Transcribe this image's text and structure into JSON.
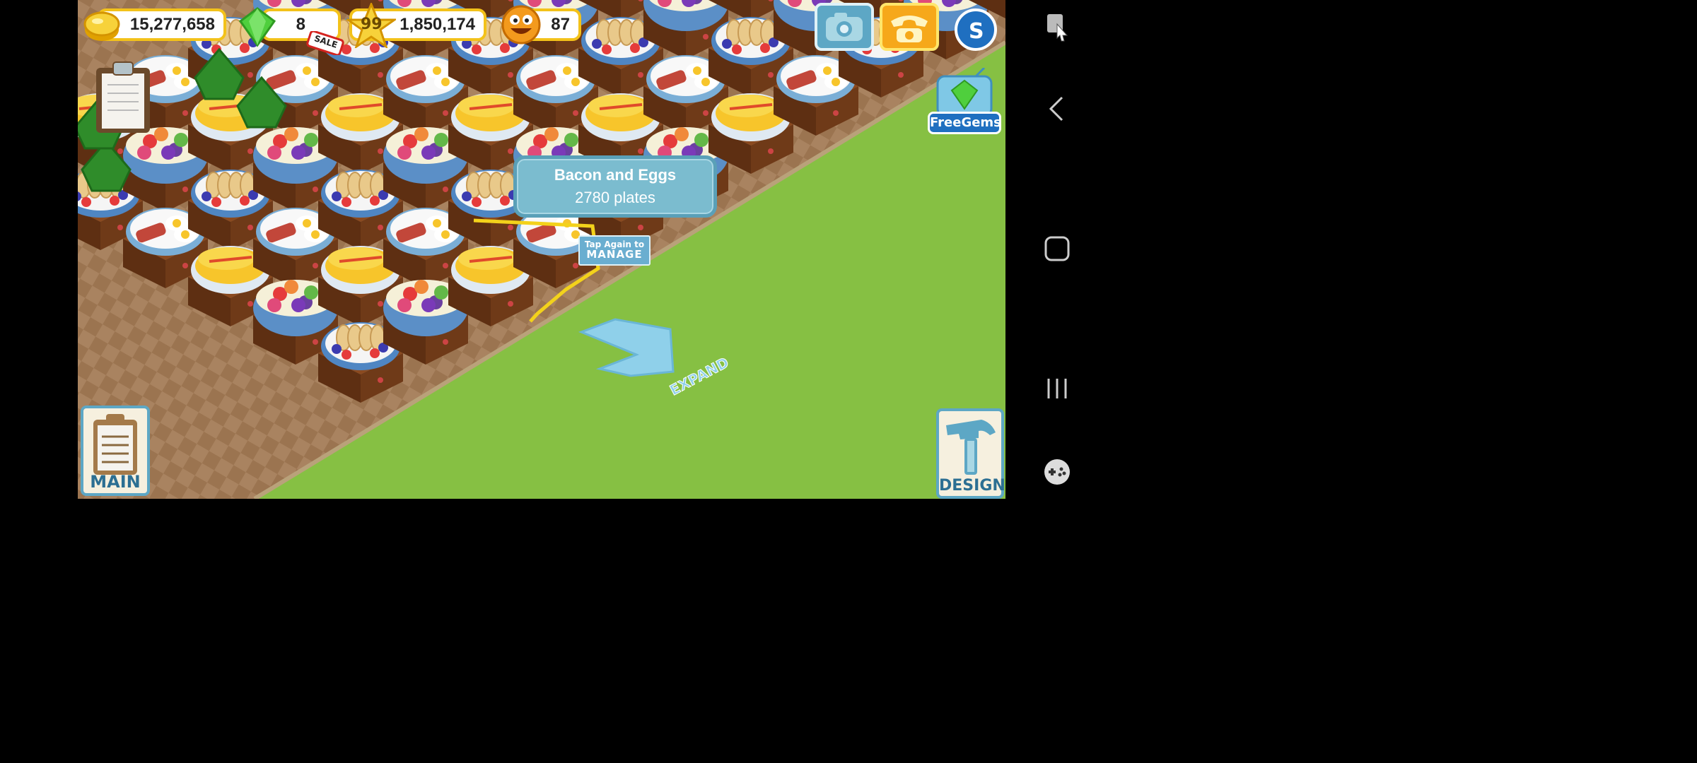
{
  "hud": {
    "coins": "15,277,658",
    "gems": "8",
    "sale_label": "SALE",
    "level": "99",
    "stars": "1,850,174",
    "mood": "87"
  },
  "tooltip": {
    "title": "Bacon and Eggs",
    "subtitle": "2780 plates"
  },
  "tap_badge": {
    "line1": "Tap Again to",
    "line2": "MANAGE"
  },
  "expand_label": "EXPAND",
  "freegems_label": "FreeGems",
  "main_button_label": "MAIN",
  "design_button_label": "DESIGN",
  "icons": {
    "coin": "coin-icon",
    "gem": "gem-icon",
    "star": "star-icon",
    "mood": "smiley-icon",
    "camera": "camera-icon",
    "phone": "phone-icon",
    "social": "social-icon",
    "clipboard": "clipboard-icon",
    "hammer": "hammer-icon",
    "expand_arrow": "expand-arrow-icon"
  },
  "colors": {
    "hud_border": "#f3c21a",
    "grass": "#86c043",
    "tooltip_bg": "#7bbccf",
    "button_border": "#5da7c5"
  }
}
